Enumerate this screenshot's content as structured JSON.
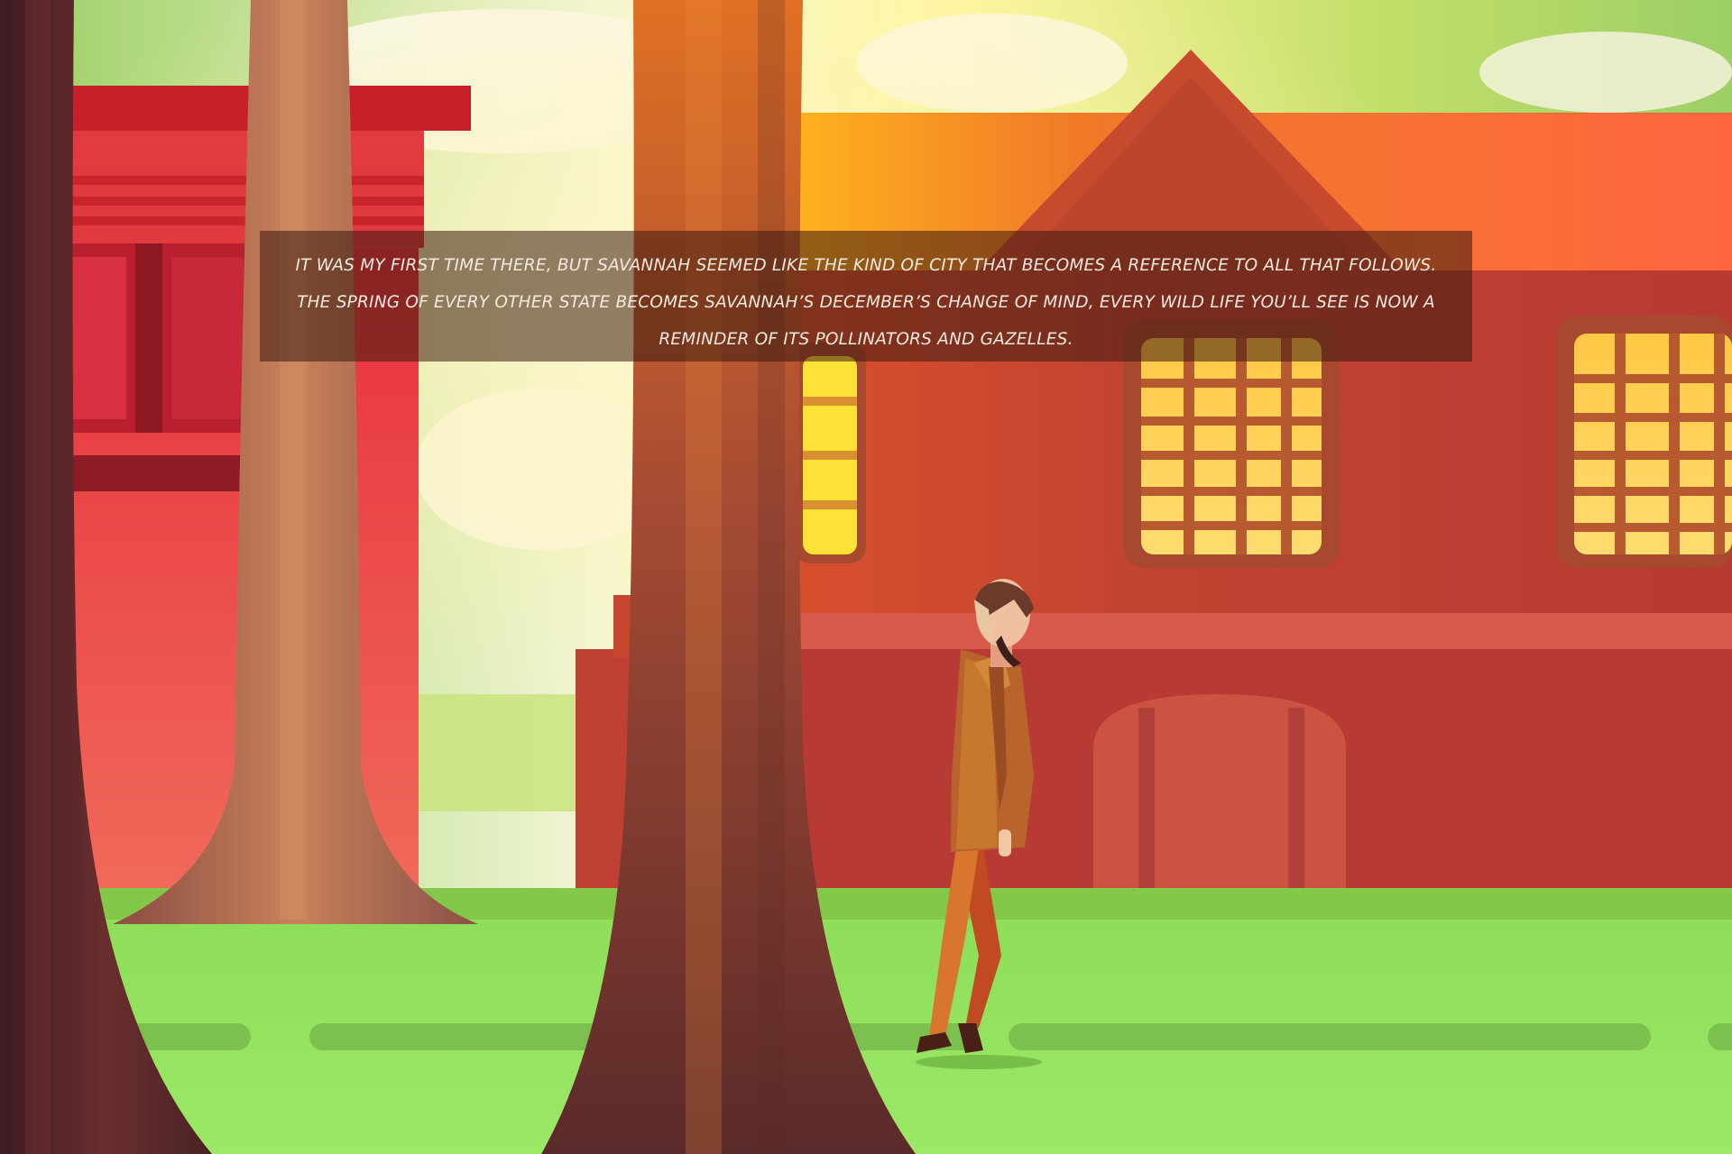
{
  "narration": {
    "text": "IT WAS MY FIRST TIME THERE, BUT SAVANNAH SEEMED LIKE THE KIND OF CITY THAT BECOMES A REFERENCE TO ALL THAT FOLLOWS. THE SPRING OF EVERY OTHER STATE BECOMES SAVANNAH’S DECEMBER’S CHANGE OF MIND, EVERY WILD LIFE YOU’LL SEE IS NOW A REMINDER OF ITS POLLINATORS AND GAZELLES."
  },
  "scene": {
    "palette": {
      "sky_top": "#a6d468",
      "sky_glow": "#fff8e8",
      "grass": "#93e65e",
      "path": "#78bd4a",
      "left_building": "#e8404a",
      "main_building": "#c24434",
      "roof": "#ff6a40",
      "window_light": "#ffd45a",
      "trunk_dark": "#4a2226",
      "trunk_light": "#c8825a"
    },
    "icons": [
      "tree-trunk",
      "building",
      "walking-man",
      "cloud",
      "window"
    ]
  }
}
